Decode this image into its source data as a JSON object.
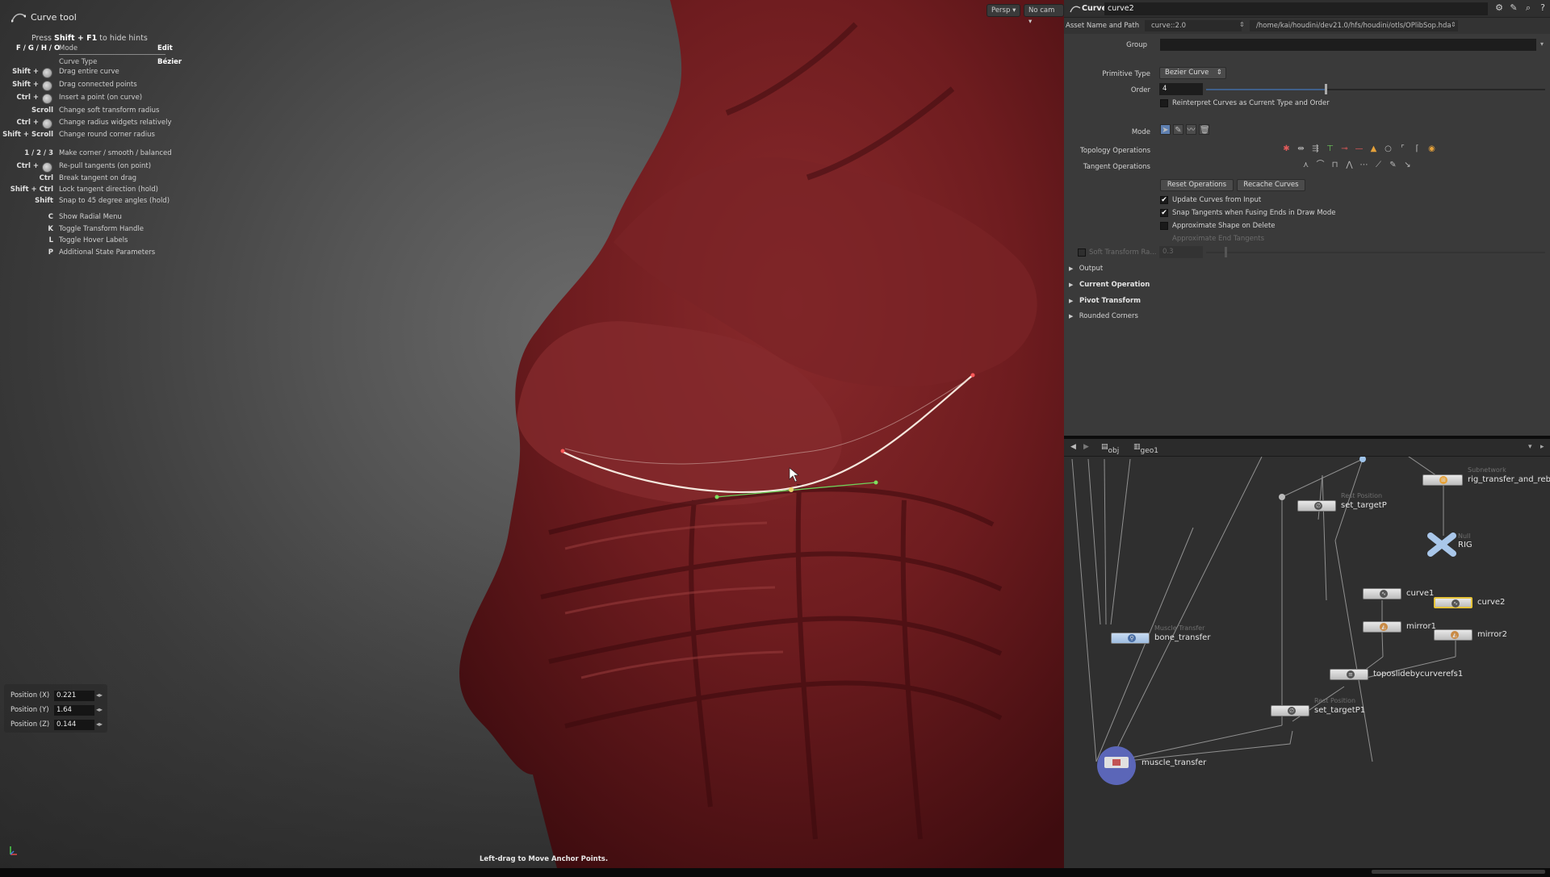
{
  "tool": {
    "title": "Curve tool",
    "press_prefix": "Press",
    "press_key": "Shift + F1",
    "press_suffix": "to hide hints",
    "mode_keys": "F / G / H / O",
    "mode_label": "Mode",
    "mode_value": "Edit",
    "curve_type_label": "Curve Type",
    "curve_type_value": "Bézier",
    "hints": [
      {
        "key": "Shift +",
        "mouse": true,
        "desc": "Drag entire curve"
      },
      {
        "key": "Shift +",
        "mouse": true,
        "desc": "Drag connected points"
      },
      {
        "key": "Ctrl +",
        "mouse": true,
        "desc": "Insert a point (on curve)"
      },
      {
        "key": "Scroll",
        "mouse": false,
        "desc": "Change soft transform radius"
      },
      {
        "key": "Ctrl +",
        "mouse": true,
        "desc": "Change radius widgets relatively"
      },
      {
        "key": "Shift + Scroll",
        "mouse": false,
        "desc": "Change round corner radius"
      },
      {
        "key": "1 / 2 / 3",
        "mouse": false,
        "desc": "Make corner / smooth / balanced"
      },
      {
        "key": "Ctrl +",
        "mouse": true,
        "desc": "Re-pull tangents (on point)"
      },
      {
        "key": "Ctrl",
        "mouse": false,
        "desc": "Break tangent on drag"
      },
      {
        "key": "Shift + Ctrl",
        "mouse": false,
        "desc": "Lock tangent direction (hold)"
      },
      {
        "key": "Shift",
        "mouse": false,
        "desc": "Snap to 45 degree angles (hold)"
      },
      {
        "key": "C",
        "mouse": false,
        "desc": "Show Radial Menu"
      },
      {
        "key": "K",
        "mouse": false,
        "desc": "Toggle Transform Handle"
      },
      {
        "key": "L",
        "mouse": false,
        "desc": "Toggle Hover Labels"
      },
      {
        "key": "P",
        "mouse": false,
        "desc": "Additional State Parameters"
      }
    ]
  },
  "viewport": {
    "persp_label": "Persp",
    "cam_label": "No cam",
    "position_x_label": "Position (X)",
    "position_x_value": "0.221",
    "position_y_label": "Position (Y)",
    "position_y_value": "1.64",
    "position_z_label": "Position (Z)",
    "position_z_value": "0.144",
    "status_message": "Left-drag to Move Anchor Points."
  },
  "params": {
    "node_type": "Curve",
    "node_name": "curve2",
    "asset_label": "Asset Name and Path",
    "asset_name": "curve::2.0",
    "asset_path": "/home/kai/houdini/dev21.0/hfs/houdini/otls/OPlibSop.hda",
    "group_label": "Group",
    "group_value": "",
    "primitive_type_label": "Primitive Type",
    "primitive_type_value": "Bezier Curve",
    "order_label": "Order",
    "order_value": "4",
    "reinterpret_label": "Reinterpret Curves as Current Type and Order",
    "mode_label": "Mode",
    "topology_label": "Topology Operations",
    "tangent_label": "Tangent Operations",
    "reset_ops_label": "Reset Operations",
    "recache_label": "Recache Curves",
    "update_curves_label": "Update Curves from Input",
    "snap_tangents_label": "Snap Tangents when Fusing Ends in Draw Mode",
    "approx_shape_label": "Approximate Shape on Delete",
    "approx_end_label": "Approximate End Tangents",
    "soft_transform_label": "Soft Transform Ra...",
    "soft_transform_value": "0.3",
    "folders": [
      "Output",
      "Current Operation",
      "Pivot Transform",
      "Rounded Corners"
    ]
  },
  "network": {
    "path_obj": "obj",
    "path_geo": "geo1",
    "nodes": {
      "rig_transfer": {
        "label": "rig_transfer_and_rebu",
        "comment": "Subnetwork"
      },
      "set_targetP": {
        "label": "set_targetP",
        "comment": "Rest Position"
      },
      "rig_null": {
        "label": "RIG",
        "comment": "Null"
      },
      "curve1": {
        "label": "curve1"
      },
      "curve2": {
        "label": "curve2"
      },
      "mirror1": {
        "label": "mirror1"
      },
      "mirror2": {
        "label": "mirror2"
      },
      "bone_transfer": {
        "label": "bone_transfer",
        "comment": "Muscle Transfer"
      },
      "toposlide": {
        "label": "toposlidebycurverefs1"
      },
      "set_targetP1": {
        "label": "set_targetP1",
        "comment": "Rest Position"
      },
      "muscle_transfer": {
        "label": "muscle_transfer"
      }
    }
  }
}
